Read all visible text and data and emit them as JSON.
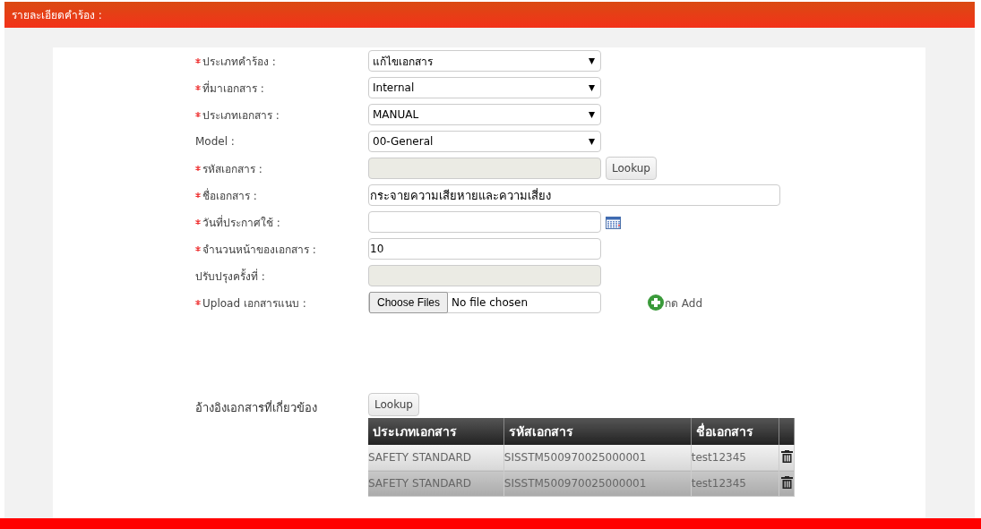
{
  "header": {
    "title": "รายละเอียดคำร้อง :"
  },
  "fields": [
    {
      "kind": "select",
      "required": true,
      "label": "ประเภทคำร้อง :",
      "value": "แก้ไขเอกสาร"
    },
    {
      "kind": "select",
      "required": true,
      "label": "ที่มาเอกสาร :",
      "value": "Internal"
    },
    {
      "kind": "select",
      "required": true,
      "label": "ประเภทเอกสาร :",
      "value": "MANUAL"
    },
    {
      "kind": "select",
      "required": false,
      "label": "Model :",
      "value": "00-General"
    },
    {
      "kind": "readonly",
      "required": true,
      "label": "รหัสเอกสาร :",
      "button": "Lookup"
    },
    {
      "kind": "wide",
      "required": true,
      "label": "ชื่อเอกสาร :",
      "value": "กระจายความเสียหายและความเสี่ยง"
    },
    {
      "kind": "date",
      "required": true,
      "label": "วันที่ประกาศใช้ :"
    },
    {
      "kind": "input",
      "required": true,
      "label": "จำนวนหน้าของเอกสาร :",
      "value": "10"
    },
    {
      "kind": "readonly",
      "required": false,
      "label": "ปรับปรุงครั้งที่ :"
    },
    {
      "kind": "file",
      "required": true,
      "label": "Upload เอกสารแนบ :",
      "button": "Choose Files",
      "value": "No file chosen",
      "add": "กด Add"
    }
  ],
  "references": {
    "label": "อ้างอิงเอกสารที่เกี่ยวข้อง",
    "button": "Lookup",
    "columns": [
      "ประเภทเอกสาร",
      "รหัสเอกสาร",
      "ชื่อเอกสาร"
    ],
    "rows": [
      [
        "SAFETY STANDARD",
        "SISSTM500970025000001",
        "test12345"
      ],
      [
        "SAFETY STANDARD",
        "SISSTM500970025000001",
        "test12345"
      ]
    ]
  }
}
